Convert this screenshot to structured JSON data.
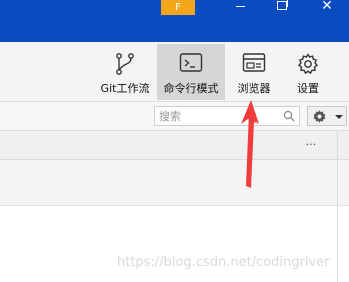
{
  "titlebar": {
    "badge": "F",
    "controls": {
      "minimize": "minimize",
      "maximize": "restore",
      "close": "✕"
    }
  },
  "ribbon": {
    "items": [
      {
        "label": "Git工作流",
        "icon": "git-branch-icon"
      },
      {
        "label": "命令行模式",
        "icon": "terminal-icon",
        "active": true
      },
      {
        "label": "浏览器",
        "icon": "browser-icon"
      },
      {
        "label": "设置",
        "icon": "gear-icon"
      }
    ]
  },
  "search": {
    "placeholder": "搜索"
  },
  "panel": {
    "more": "..."
  },
  "annotation": {
    "color": "#f03c3c",
    "target": "浏览器"
  },
  "watermark": "https://blog.csdn.net/codingriver",
  "colors": {
    "titlebar": "#0a4bc0",
    "badge": "#f5a51b",
    "active_ribbon": "#d6d6d6"
  }
}
